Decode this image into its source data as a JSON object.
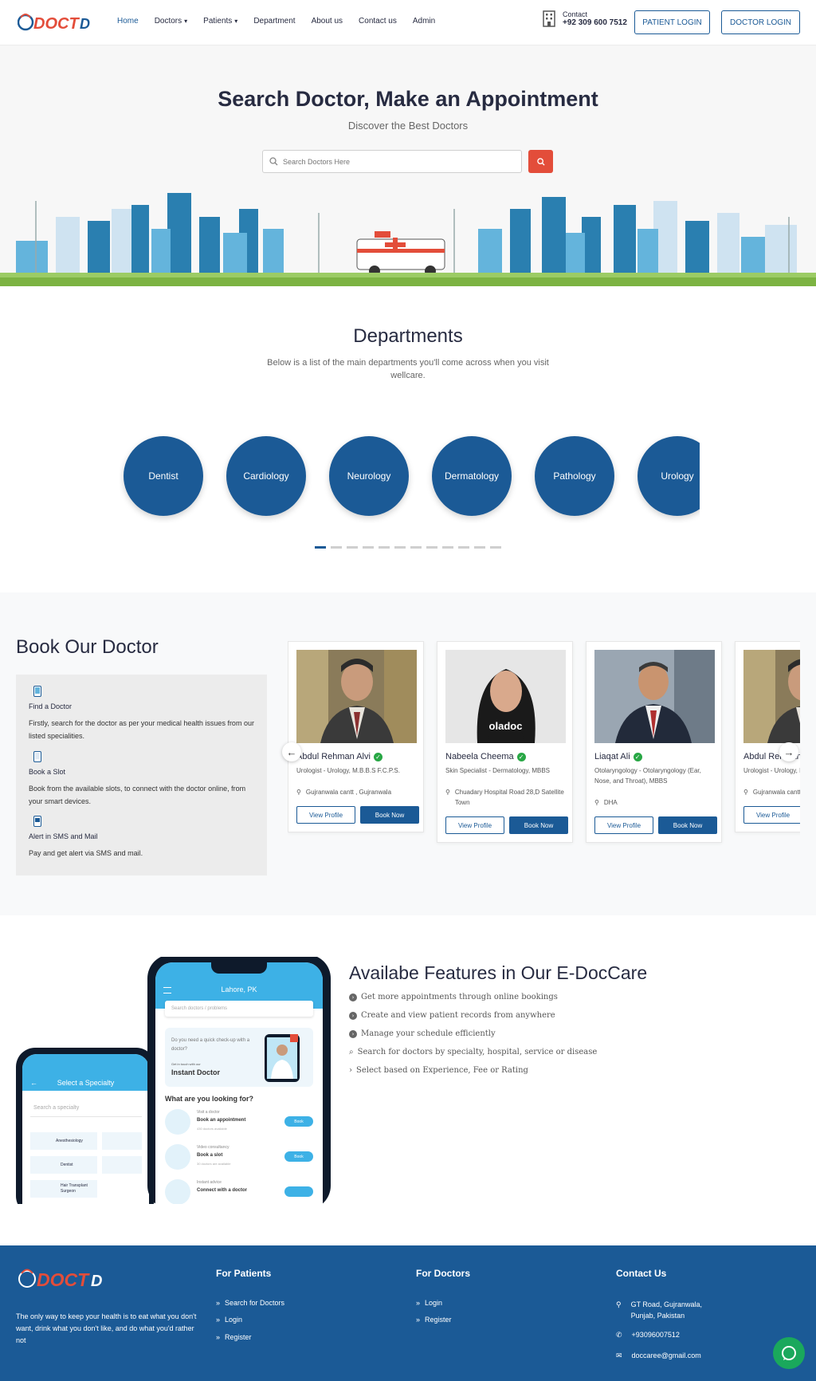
{
  "header": {
    "logo_text": "DOCTD",
    "nav": [
      {
        "label": "Home",
        "dropdown": false,
        "active": true
      },
      {
        "label": "Doctors",
        "dropdown": true,
        "active": false
      },
      {
        "label": "Patients",
        "dropdown": true,
        "active": false
      },
      {
        "label": "Department",
        "dropdown": false,
        "active": false
      },
      {
        "label": "About us",
        "dropdown": false,
        "active": false
      },
      {
        "label": "Contact us",
        "dropdown": false,
        "active": false
      },
      {
        "label": "Admin",
        "dropdown": false,
        "active": false
      }
    ],
    "contact_label": "Contact",
    "contact_phone": "+92 309 600 7512",
    "patient_login": "PATIENT LOGIN",
    "doctor_login": "DOCTOR LOGIN"
  },
  "hero": {
    "title": "Search Doctor, Make an Appointment",
    "subtitle": "Discover the Best Doctors",
    "search_placeholder": "Search Doctors Here"
  },
  "departments": {
    "title": "Departments",
    "subtitle": "Below is a list of the main departments you'll come across when you visit wellcare.",
    "items": [
      "Dentist",
      "Cardiology",
      "Neurology",
      "Dermatology",
      "Pathology",
      "Urology"
    ],
    "dot_count": 12,
    "active_dot": 0
  },
  "book": {
    "title": "Book Our Doctor",
    "steps": [
      {
        "title": "Find a Doctor",
        "desc": "Firstly, search for the doctor as per your medical health issues from our listed specialities."
      },
      {
        "title": "Book a Slot",
        "desc": "Book from the available slots, to connect with the doctor online, from your smart devices."
      },
      {
        "title": "Alert in SMS and Mail",
        "desc": "Pay and get alert via SMS and mail."
      }
    ],
    "doctors": [
      {
        "name": "Abdul Rehman Alvi",
        "specialty": "Urologist - Urology, M.B.B.S F.C.P.S.",
        "location": "Gujranwala cantt , Gujranwala"
      },
      {
        "name": "Nabeela Cheema",
        "specialty": "Skin Specialist - Dermatology, MBBS",
        "location": "Chuadary Hospital Road 28,D Satellite Town",
        "watermark": "oladoc"
      },
      {
        "name": "Liaqat Ali",
        "specialty": "Otolaryngology - Otolaryngology (Ear, Nose, and Throat), MBBS",
        "location": "DHA"
      },
      {
        "name": "Abdul Rehman Alvi",
        "specialty": "Urologist - Urology, M.B.B.S F.C.P.S.",
        "location": "Gujranwala cantt , Gujranwala"
      }
    ],
    "view_label": "View Profile",
    "book_label": "Book Now"
  },
  "features": {
    "title": "Availabe Features in Our E-DocCare",
    "items": [
      "Get more appointments through online bookings",
      "Create and view patient records from anywhere",
      "Manage your schedule efficiently",
      "Search for doctors by specialty, hospital, service or disease",
      "Select based on Experience, Fee or Rating"
    ],
    "phone_back": {
      "header": "Select a Specialty",
      "search": "Search a specialty",
      "tiles": [
        "Anesthesiology",
        "Dentist",
        "Hair Transplant Surgeon"
      ]
    },
    "phone_front": {
      "location": "Lahore, PK",
      "search": "Search doctors / problems",
      "promo_q": "Do you need a quick check-up with a doctor?",
      "promo_small": "Get in touch with our",
      "promo_big": "Instant Doctor",
      "looking": "What are you looking for?",
      "options": [
        {
          "small": "Visit a doctor",
          "big": "Book an appointment",
          "note": "430 doctors available",
          "btn": "Book"
        },
        {
          "small": "Video consultancy",
          "big": "Book a slot",
          "note": "30 doctors are available",
          "btn": "Book"
        },
        {
          "small": "Instant advice",
          "big": "Connect with a doctor",
          "note": "",
          "btn": ""
        }
      ]
    }
  },
  "footer": {
    "about": "The only way to keep your health is to eat what you don't want, drink what you don't like, and do what you'd rather not",
    "patients_title": "For Patients",
    "patients_links": [
      "Search for Doctors",
      "Login",
      "Register"
    ],
    "doctors_title": "For Doctors",
    "doctors_links": [
      "Login",
      "Register"
    ],
    "contact_title": "Contact Us",
    "address": "GT Road, Gujranwala, Punjab, Pakistan",
    "phone": "+93096007512",
    "email": "doccaree@gmail.com"
  },
  "colors": {
    "primary": "#1b5a96",
    "accent": "#e34d3a",
    "bg_light": "#f7f7f7",
    "success": "#28a745",
    "chat": "#1aa85c"
  },
  "icons": [
    "building-icon",
    "search-icon",
    "phone-icon",
    "message-icon",
    "alert-icon",
    "chevron-right-icon",
    "map-marker-icon",
    "mail-icon",
    "chat-icon",
    "check-icon"
  ]
}
